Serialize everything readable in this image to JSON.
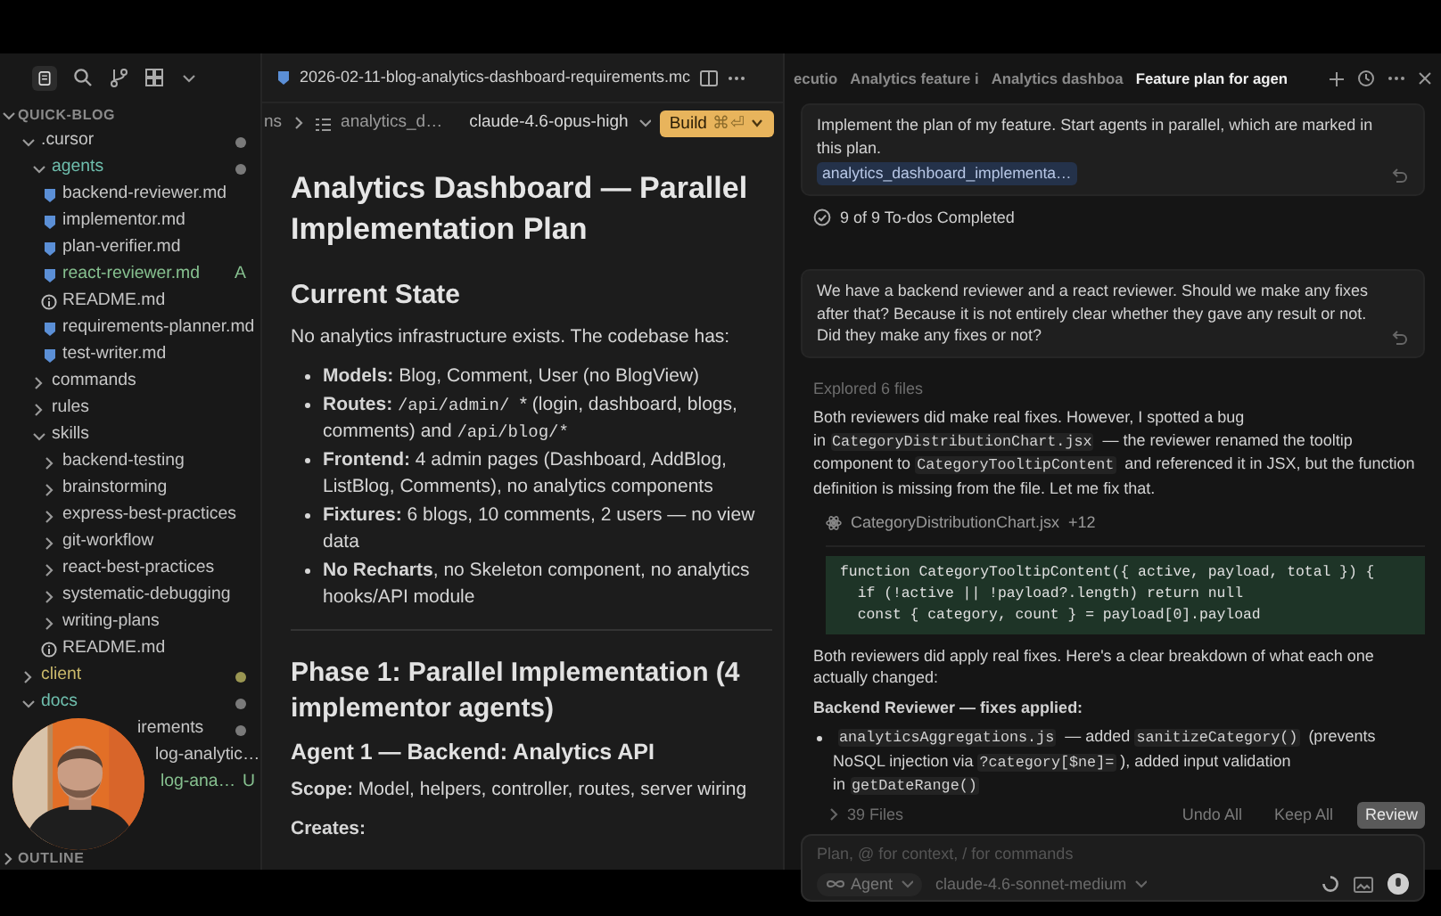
{
  "explorer": {
    "title": "QUICK-BLOG",
    "tree": [
      {
        "label": ".cursor",
        "kind": "folder",
        "expanded": true,
        "dot": {
          "color": "#7a7a7a"
        },
        "children": [
          {
            "label": "agents",
            "kind": "folder",
            "expanded": true,
            "color": "#6fbfae",
            "dot": {
              "color": "#7a7a7a"
            },
            "children": [
              {
                "label": "backend-reviewer.md",
                "kind": "markdown"
              },
              {
                "label": "implementor.md",
                "kind": "markdown"
              },
              {
                "label": "plan-verifier.md",
                "kind": "markdown"
              },
              {
                "label": "react-reviewer.md",
                "kind": "markdown",
                "color": "#86c08f",
                "badge": "A"
              },
              {
                "label": "README.md",
                "kind": "info"
              },
              {
                "label": "requirements-planner.md",
                "kind": "markdown"
              },
              {
                "label": "test-writer.md",
                "kind": "markdown"
              }
            ]
          },
          {
            "label": "commands",
            "kind": "folder",
            "expanded": false
          },
          {
            "label": "rules",
            "kind": "folder",
            "expanded": false
          },
          {
            "label": "skills",
            "kind": "folder",
            "expanded": true,
            "children": [
              {
                "label": "backend-testing",
                "kind": "folder",
                "expanded": false
              },
              {
                "label": "brainstorming",
                "kind": "folder",
                "expanded": false
              },
              {
                "label": "express-best-practices",
                "kind": "folder",
                "expanded": false
              },
              {
                "label": "git-workflow",
                "kind": "folder",
                "expanded": false
              },
              {
                "label": "react-best-practices",
                "kind": "folder",
                "expanded": false
              },
              {
                "label": "systematic-debugging",
                "kind": "folder",
                "expanded": false
              },
              {
                "label": "writing-plans",
                "kind": "folder",
                "expanded": false
              },
              {
                "label": "README.md",
                "kind": "info"
              }
            ]
          }
        ]
      },
      {
        "label": "client",
        "kind": "folder",
        "expanded": false,
        "color": "#c9b86a",
        "dot": {
          "color": "#9a9652"
        }
      },
      {
        "label": "docs",
        "kind": "folder",
        "expanded": true,
        "color": "#6fbfae",
        "dot": {
          "color": "#7a7a7a"
        },
        "children": [
          {
            "label": "irements",
            "kind": "partial",
            "dot": {
              "color": "#7a7a7a"
            }
          },
          {
            "label": "log-analytic…",
            "kind": "partial"
          },
          {
            "label": "log-ana…",
            "kind": "partial",
            "color": "#86c08f",
            "badge": "U"
          }
        ]
      }
    ],
    "outline_title": "OUTLINE"
  },
  "editor": {
    "tab": "2026-02-11-blog-analytics-dashboard-requirements.mc",
    "breadcrumb": {
      "prefix": "ns",
      "file": "analytics_d…",
      "model": "claude-4.6-opus-high",
      "build": "Build",
      "shortcut": "⌘⏎"
    },
    "document": [
      {
        "kind": "h1",
        "text": "Analytics Dashboard — Parallel Implementation Plan"
      },
      {
        "kind": "h2",
        "text": "Current State"
      },
      {
        "kind": "p",
        "parts": [
          {
            "text": "No analytics infrastructure exists. The codebase has:"
          }
        ]
      },
      {
        "kind": "li",
        "parts": [
          {
            "text": "Models:",
            "kind": "bold"
          },
          {
            "text": " Blog, Comment, User (no BlogView)"
          }
        ]
      },
      {
        "kind": "li",
        "parts": [
          {
            "text": "Routes:",
            "kind": "bold"
          },
          {
            "text": "/api/admin/",
            "kind": "code"
          },
          {
            "text": " * (login, dashboard, blogs, comments) and"
          },
          {
            "text": "/api/blog/*",
            "kind": "code"
          }
        ]
      },
      {
        "kind": "li",
        "parts": [
          {
            "text": "Frontend:",
            "kind": "bold"
          },
          {
            "text": " 4 admin pages (Dashboard, AddBlog, ListBlog, Comments), no analytics components"
          }
        ]
      },
      {
        "kind": "li",
        "parts": [
          {
            "text": "Fixtures:",
            "kind": "bold"
          },
          {
            "text": " 6 blogs, 10 comments, 2 users — no view data"
          }
        ]
      },
      {
        "kind": "li",
        "parts": [
          {
            "text": "No Recharts",
            "kind": "bold"
          },
          {
            "text": ", no Skeleton component, no analytics hooks/API module"
          }
        ]
      },
      {
        "kind": "hr"
      },
      {
        "kind": "h2",
        "text": "Phase 1: Parallel Implementation (4 implementor agents)"
      },
      {
        "kind": "h3",
        "text": "Agent 1 — Backend: Analytics API"
      },
      {
        "kind": "p",
        "parts": [
          {
            "text": "Scope:",
            "kind": "bold"
          },
          {
            "text": " Model, helpers, controller, routes, server wiring"
          }
        ]
      },
      {
        "kind": "p",
        "parts": [
          {
            "text": "Creates:",
            "kind": "bold"
          }
        ]
      }
    ]
  },
  "chat": {
    "tabs": [
      {
        "label": "ecutio",
        "selected": false
      },
      {
        "label": "Analytics feature i",
        "selected": false
      },
      {
        "label": "Analytics dashboa",
        "selected": false
      },
      {
        "label": "Feature plan for agen",
        "selected": true
      }
    ],
    "messages": [
      {
        "kind": "user",
        "parts": [
          {
            "text": "Implement the plan of my feature. Start agents in parallel, which are marked in this plan."
          }
        ],
        "chip": "analytics_dashboard_implementa…"
      },
      {
        "kind": "status",
        "text": "9 of 9 To-dos Completed"
      },
      {
        "kind": "user",
        "parts": [
          {
            "text": "We have a backend reviewer and a react reviewer. Should we make any fixes after that? Because it is not entirely clear whether they gave any result or not. Did they make any fixes or not?"
          }
        ]
      },
      {
        "kind": "note",
        "text": "Explored 6 files"
      },
      {
        "kind": "paragraph",
        "parts": [
          {
            "text": "Both reviewers did make real fixes. However, I spotted a bug in"
          },
          {
            "text": "CategoryDistributionChart.jsx",
            "kind": "code"
          },
          {
            "text": " — the reviewer renamed the tooltip component to"
          },
          {
            "text": "CategoryTooltipContent",
            "kind": "code"
          },
          {
            "text": " and referenced it in JSX, but the function definition is missing from the file. Let me fix that."
          }
        ]
      },
      {
        "kind": "file",
        "text": "CategoryDistributionChart.jsx",
        "extra": "+12"
      },
      {
        "kind": "code",
        "lines": [
          "function CategoryTooltipContent({ active, payload, total }) {",
          "  if (!active || !payload?.length) return null",
          "  const { category, count } = payload[0].payload"
        ]
      },
      {
        "kind": "paragraph",
        "parts": [
          {
            "text": "Both reviewers did apply real fixes. Here's a clear breakdown of what each one actually changed:"
          }
        ]
      },
      {
        "kind": "heading",
        "text": "Backend Reviewer — fixes applied:"
      },
      {
        "kind": "bullet",
        "parts": [
          {
            "text": "analyticsAggregations.js",
            "kind": "code"
          },
          {
            "text": " — added"
          },
          {
            "text": "sanitizeCategory()",
            "kind": "code"
          },
          {
            "text": " (prevents NoSQL injection via"
          },
          {
            "text": "?category[$ne]=",
            "kind": "code"
          },
          {
            "text": "), added input validation in"
          },
          {
            "text": "getDateRange()",
            "kind": "code"
          }
        ]
      }
    ],
    "changes": {
      "files": "39 Files",
      "actions": [
        {
          "label": "Undo All",
          "primary": false
        },
        {
          "label": "Keep All",
          "primary": false
        },
        {
          "label": "Review",
          "primary": true
        }
      ]
    },
    "composer": {
      "placeholder": "Plan, @ for context, / for commands",
      "mode": "Agent",
      "model": "claude-4.6-sonnet-medium"
    }
  }
}
